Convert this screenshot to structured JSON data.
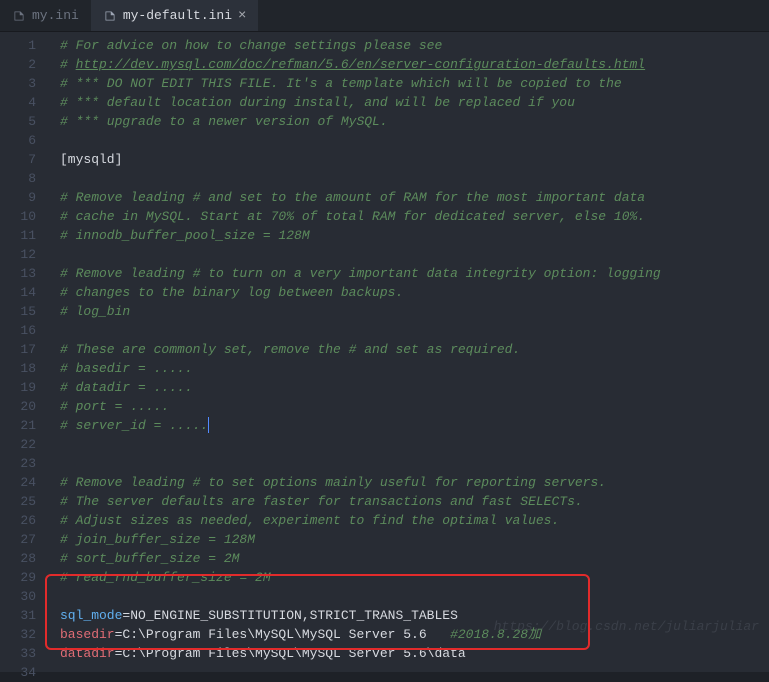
{
  "tabs": [
    {
      "label": "my.ini",
      "active": false
    },
    {
      "label": "my-default.ini",
      "active": true
    }
  ],
  "lines": [
    {
      "num": 1,
      "segments": [
        {
          "cls": "comment",
          "text": "# For advice on how to change settings please see"
        }
      ]
    },
    {
      "num": 2,
      "segments": [
        {
          "cls": "comment",
          "text": "# "
        },
        {
          "cls": "comment-link",
          "text": "http://dev.mysql.com/doc/refman/5.6/en/server-configuration-defaults.html"
        }
      ]
    },
    {
      "num": 3,
      "segments": [
        {
          "cls": "comment",
          "text": "# *** DO NOT EDIT THIS FILE. It's a template which will be copied to the"
        }
      ]
    },
    {
      "num": 4,
      "segments": [
        {
          "cls": "comment",
          "text": "# *** default location during install, and will be replaced if you"
        }
      ]
    },
    {
      "num": 5,
      "segments": [
        {
          "cls": "comment",
          "text": "# *** upgrade to a newer version of MySQL."
        }
      ]
    },
    {
      "num": 6,
      "segments": []
    },
    {
      "num": 7,
      "segments": [
        {
          "cls": "section",
          "text": "[mysqld]"
        }
      ]
    },
    {
      "num": 8,
      "segments": []
    },
    {
      "num": 9,
      "segments": [
        {
          "cls": "comment",
          "text": "# Remove leading # and set to the amount of RAM for the most important data"
        }
      ]
    },
    {
      "num": 10,
      "segments": [
        {
          "cls": "comment",
          "text": "# cache in MySQL. Start at 70% of total RAM for dedicated server, else 10%."
        }
      ]
    },
    {
      "num": 11,
      "segments": [
        {
          "cls": "comment",
          "text": "# innodb_buffer_pool_size = 128M"
        }
      ]
    },
    {
      "num": 12,
      "segments": []
    },
    {
      "num": 13,
      "segments": [
        {
          "cls": "comment",
          "text": "# Remove leading # to turn on a very important data integrity option: logging"
        }
      ]
    },
    {
      "num": 14,
      "segments": [
        {
          "cls": "comment",
          "text": "# changes to the binary log between backups."
        }
      ]
    },
    {
      "num": 15,
      "segments": [
        {
          "cls": "comment",
          "text": "# log_bin"
        }
      ]
    },
    {
      "num": 16,
      "segments": []
    },
    {
      "num": 17,
      "segments": [
        {
          "cls": "comment",
          "text": "# These are commonly set, remove the # and set as required."
        }
      ]
    },
    {
      "num": 18,
      "segments": [
        {
          "cls": "comment",
          "text": "# basedir = ....."
        }
      ]
    },
    {
      "num": 19,
      "segments": [
        {
          "cls": "comment",
          "text": "# datadir = ....."
        }
      ]
    },
    {
      "num": 20,
      "segments": [
        {
          "cls": "comment",
          "text": "# port = ....."
        }
      ]
    },
    {
      "num": 21,
      "segments": [
        {
          "cls": "comment",
          "text": "# server_id = ....."
        }
      ],
      "cursor": true
    },
    {
      "num": 22,
      "segments": []
    },
    {
      "num": 23,
      "segments": []
    },
    {
      "num": 24,
      "segments": [
        {
          "cls": "comment",
          "text": "# Remove leading # to set options mainly useful for reporting servers."
        }
      ]
    },
    {
      "num": 25,
      "segments": [
        {
          "cls": "comment",
          "text": "# The server defaults are faster for transactions and fast SELECTs."
        }
      ]
    },
    {
      "num": 26,
      "segments": [
        {
          "cls": "comment",
          "text": "# Adjust sizes as needed, experiment to find the optimal values."
        }
      ]
    },
    {
      "num": 27,
      "segments": [
        {
          "cls": "comment",
          "text": "# join_buffer_size = 128M"
        }
      ]
    },
    {
      "num": 28,
      "segments": [
        {
          "cls": "comment",
          "text": "# sort_buffer_size = 2M"
        }
      ]
    },
    {
      "num": 29,
      "segments": [
        {
          "cls": "comment",
          "text": "# read_rnd_buffer_size = 2M"
        }
      ]
    },
    {
      "num": 30,
      "segments": []
    },
    {
      "num": 31,
      "segments": [
        {
          "cls": "key-blue",
          "text": "sql_mode"
        },
        {
          "cls": "value",
          "text": "=NO_ENGINE_SUBSTITUTION,STRICT_TRANS_TABLES"
        }
      ]
    },
    {
      "num": 32,
      "segments": [
        {
          "cls": "key",
          "text": "basedir"
        },
        {
          "cls": "value",
          "text": "=C:\\Program Files\\MySQL\\MySQL Server 5.6   "
        },
        {
          "cls": "comment",
          "text": "#2018.8.28加"
        }
      ]
    },
    {
      "num": 33,
      "segments": [
        {
          "cls": "key",
          "text": "datadir"
        },
        {
          "cls": "value",
          "text": "=C:\\Program Files\\MySQL\\MySQL Server 5.6\\data"
        }
      ]
    },
    {
      "num": 34,
      "segments": []
    }
  ],
  "watermark": "https://blog.csdn.net/juliarjuliar"
}
